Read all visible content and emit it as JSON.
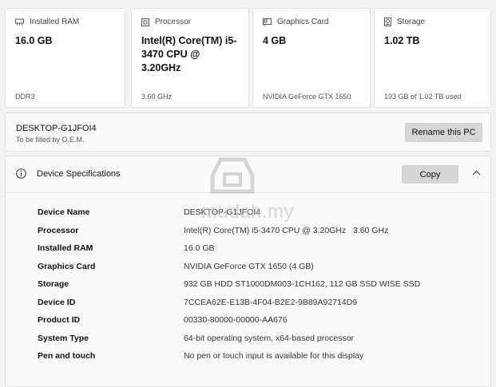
{
  "cards": [
    {
      "icon": "ram-icon",
      "label": "Installed RAM",
      "value": "16.0 GB",
      "sub": "DDR3"
    },
    {
      "icon": "processor-icon",
      "label": "Processor",
      "value": "Intel(R) Core(TM) i5-3470 CPU @ 3.20GHz",
      "sub": "3.60 GHz"
    },
    {
      "icon": "graphics-card-icon",
      "label": "Graphics Card",
      "value": "4 GB",
      "sub": "NVIDIA GeForce GTX 1650"
    },
    {
      "icon": "storage-icon",
      "label": "Storage",
      "value": "1.02 TB",
      "sub": "193 GB of 1.02 TB used"
    }
  ],
  "pc": {
    "name": "DESKTOP-G1JFOI4",
    "subtitle": "To be filled by O.E.M.",
    "rename_label": "Rename this PC"
  },
  "device_specs": {
    "title": "Device Specifications",
    "copy_label": "Copy",
    "rows": [
      {
        "label": "Device Name",
        "value": "DESKTOP-G1JFOI4"
      },
      {
        "label": "Processor",
        "value": "Intel(R) Core(TM) i5-3470 CPU @ 3.20GHz   3.60 GHz"
      },
      {
        "label": "Installed RAM",
        "value": "16.0 GB"
      },
      {
        "label": "Graphics Card",
        "value": "NVIDIA GeForce GTX 1650 (4 GB)"
      },
      {
        "label": "Storage",
        "value": "932 GB HDD ST1000DM003-1CH162, 112 GB SSD WISE SSD"
      },
      {
        "label": "Device ID",
        "value": "7CCEA62E-E13B-4F04-B2E2-9B89A92714D9"
      },
      {
        "label": "Product ID",
        "value": "00330-80000-00000-AA676"
      },
      {
        "label": "System Type",
        "value": "64-bit operating system, x64-based processor"
      },
      {
        "label": "Pen and touch",
        "value": "No pen or touch input is available for this display"
      }
    ]
  },
  "watermark": {
    "text": "mudah.my"
  }
}
